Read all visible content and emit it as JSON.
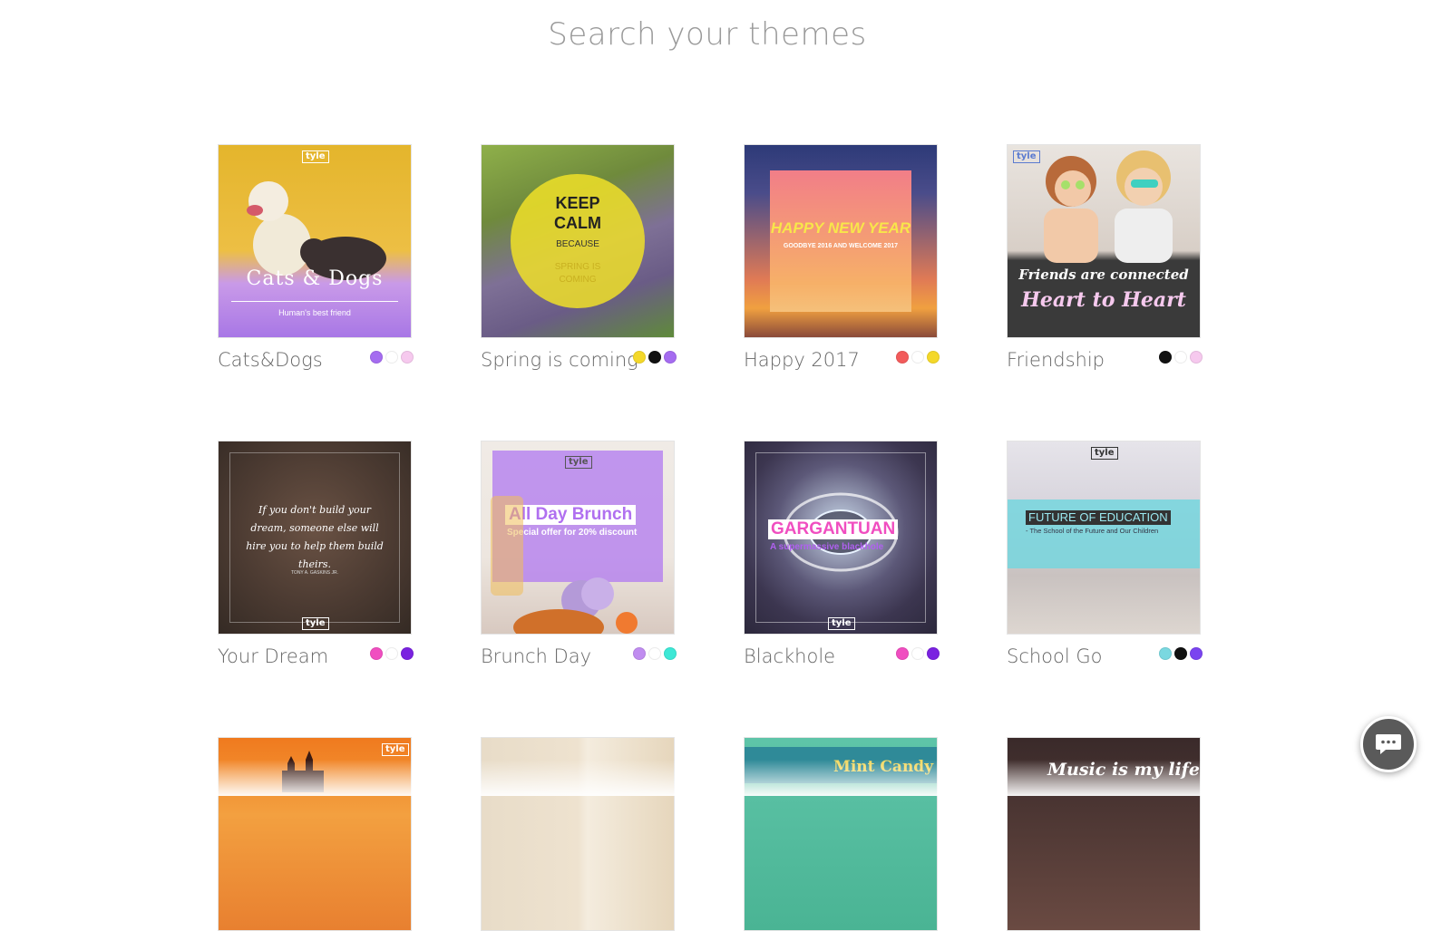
{
  "header": {
    "title": "Search your themes"
  },
  "themes": [
    {
      "name": "Cats&Dogs",
      "title": "Cats & Dogs",
      "subtitle": "Human's best friend",
      "colors": [
        "#a56cf0",
        "#ffffff",
        "#f6c9ee"
      ]
    },
    {
      "name": "Spring is coming",
      "title1": "KEEP",
      "title2": "CALM",
      "title3": "BECAUSE",
      "subtitle": "SPRING IS COMING",
      "colors": [
        "#f4d82a",
        "#111111",
        "#a56cf0"
      ]
    },
    {
      "name": "Happy 2017",
      "title": "HAPPY NEW YEAR",
      "subtitle": "GOODBYE 2016 AND WELCOME 2017",
      "colors": [
        "#f25b5b",
        "#ffffff",
        "#f4d82a"
      ]
    },
    {
      "name": "Friendship",
      "title1": "Friends are connected",
      "title2": "Heart to Heart",
      "colors": [
        "#111111",
        "#ffffff",
        "#f6c9ee"
      ]
    },
    {
      "name": "Your Dream",
      "quote": "If you don't build your dream, someone else will hire you to help them build theirs.",
      "author": "TONY A. GASKINS JR.",
      "colors": [
        "#f04ec0",
        "#ffffff",
        "#7a22e0"
      ]
    },
    {
      "name": "Brunch Day",
      "title": "All Day Brunch",
      "subtitle": "Special offer for 20% discount",
      "colors": [
        "#c08cf0",
        "#ffffff",
        "#3de8d6"
      ]
    },
    {
      "name": "Blackhole",
      "title": "GARGANTUAN",
      "subtitle": "A supermassive blackhole",
      "colors": [
        "#f04ec0",
        "#ffffff",
        "#7a22e0"
      ]
    },
    {
      "name": "School Go",
      "title": "FUTURE OF EDUCATION",
      "subtitle": "- The School of the Future and Our Children",
      "colors": [
        "#7ad8e0",
        "#111111",
        "#7a44f0"
      ]
    },
    {
      "name": ""
    },
    {
      "name": ""
    },
    {
      "name": "",
      "title": "Mint Candy"
    },
    {
      "name": "",
      "title": "Music is my life"
    }
  ],
  "brand": {
    "logo": "tyle"
  },
  "chat": {
    "icon": "chat-bubble-icon"
  }
}
